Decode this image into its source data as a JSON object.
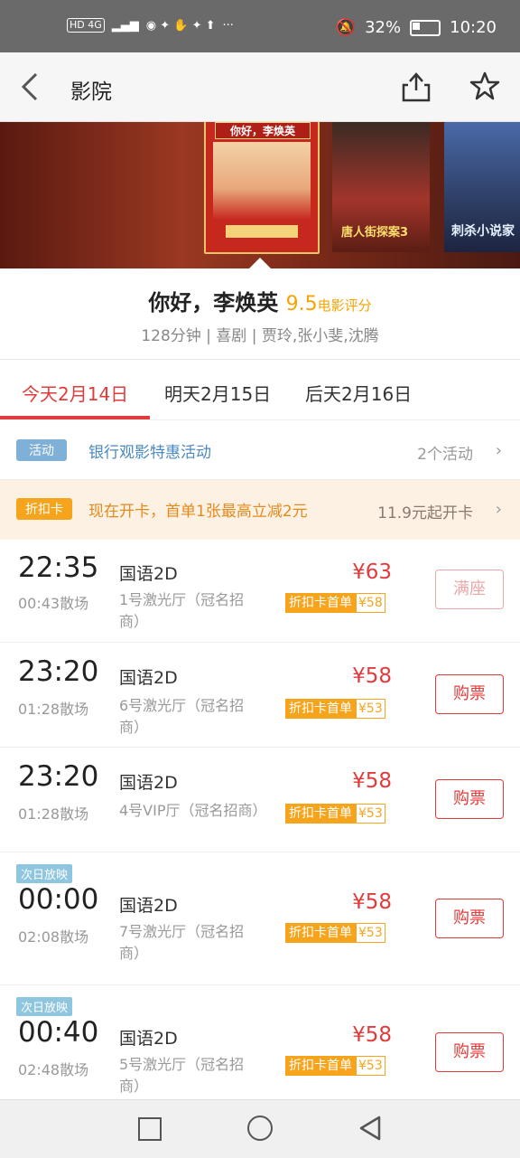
{
  "status": {
    "left": "HD 4G",
    "battery": "32%",
    "time": "10:20",
    "more": "···"
  },
  "header": {
    "title": "影院"
  },
  "posters": [
    {
      "text": "你好，李焕英"
    },
    {
      "text": "唐人街探案3"
    },
    {
      "text": "刺杀小说家"
    }
  ],
  "movie": {
    "name": "你好，李焕英",
    "score": "9.5",
    "score_label": "电影评分",
    "info": "128分钟 | 喜剧 | 贾玲,张小斐,沈腾"
  },
  "dates": [
    "今天2月14日",
    "明天2月15日",
    "后天2月16日"
  ],
  "promo": {
    "tag": "活动",
    "text": "银行观影特惠活动",
    "count": "2个活动",
    "chevron": "›"
  },
  "card": {
    "tag": "折扣卡",
    "text": "现在开卡，首单1张最高立减2元",
    "price": "11.9元起开卡",
    "chevron": "›"
  },
  "showtimes": [
    {
      "tag": "",
      "time": "22:35",
      "end": "00:43散场",
      "lang": "国语2D",
      "hall": "1号激光厅（冠名招商）",
      "price": "¥63",
      "disc_label": "折扣卡首单",
      "disc_price": "¥58",
      "button": "满座"
    },
    {
      "tag": "",
      "time": "23:20",
      "end": "01:28散场",
      "lang": "国语2D",
      "hall": "6号激光厅（冠名招商）",
      "price": "¥58",
      "disc_label": "折扣卡首单",
      "disc_price": "¥53",
      "button": "购票"
    },
    {
      "tag": "",
      "time": "23:20",
      "end": "01:28散场",
      "lang": "国语2D",
      "hall": "4号VIP厅（冠名招商）",
      "price": "¥58",
      "disc_label": "折扣卡首单",
      "disc_price": "¥53",
      "button": "购票"
    },
    {
      "tag": "次日放映",
      "time": "00:00",
      "end": "02:08散场",
      "lang": "国语2D",
      "hall": "7号激光厅（冠名招商）",
      "price": "¥58",
      "disc_label": "折扣卡首单",
      "disc_price": "¥53",
      "button": "购票"
    },
    {
      "tag": "次日放映",
      "time": "00:40",
      "end": "02:48散场",
      "lang": "国语2D",
      "hall": "5号激光厅（冠名招商）",
      "price": "¥58",
      "disc_label": "折扣卡首单",
      "disc_price": "¥53",
      "button": "购票"
    }
  ],
  "icons": {
    "back": "back-arrow-icon",
    "share": "share-icon",
    "star": "star-icon"
  },
  "colors": {
    "accent": "#e23b3b",
    "orange": "#f7a41d",
    "score": "#f7a400",
    "blue": "#4b8ac0"
  }
}
